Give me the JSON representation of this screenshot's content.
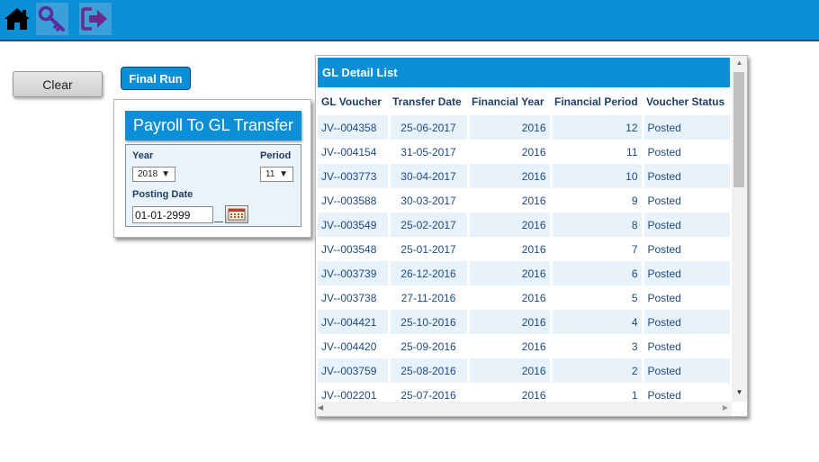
{
  "topbar": {
    "color": "#0b8fd6",
    "icons": [
      "home-icon",
      "key-icon",
      "logout-icon"
    ]
  },
  "actions": {
    "clear_label": "Clear",
    "final_run_label": "Final Run"
  },
  "payroll": {
    "title": "Payroll To GL Transfer",
    "year_label": "Year",
    "year_value": "2018",
    "period_label": "Period",
    "period_value": "11",
    "posting_date_label": "Posting Date",
    "posting_date_value": "01-01-2999"
  },
  "gl_detail": {
    "title": "GL Detail List",
    "columns": [
      "GL Voucher",
      "Transfer Date",
      "Financial Year",
      "Financial Period",
      "Voucher Status"
    ],
    "rows": [
      [
        "JV--004358",
        "25-06-2017",
        "2016",
        "12",
        "Posted"
      ],
      [
        "JV--004154",
        "31-05-2017",
        "2016",
        "11",
        "Posted"
      ],
      [
        "JV--003773",
        "30-04-2017",
        "2016",
        "10",
        "Posted"
      ],
      [
        "JV--003588",
        "30-03-2017",
        "2016",
        "9",
        "Posted"
      ],
      [
        "JV--003549",
        "25-02-2017",
        "2016",
        "8",
        "Posted"
      ],
      [
        "JV--003548",
        "25-01-2017",
        "2016",
        "7",
        "Posted"
      ],
      [
        "JV--003739",
        "26-12-2016",
        "2016",
        "6",
        "Posted"
      ],
      [
        "JV--003738",
        "27-11-2016",
        "2016",
        "5",
        "Posted"
      ],
      [
        "JV--004421",
        "25-10-2016",
        "2016",
        "4",
        "Posted"
      ],
      [
        "JV--004420",
        "25-09-2016",
        "2016",
        "3",
        "Posted"
      ],
      [
        "JV--003759",
        "25-08-2016",
        "2016",
        "2",
        "Posted"
      ],
      [
        "JV--002201",
        "25-07-2016",
        "2016",
        "1",
        "Posted"
      ]
    ]
  }
}
